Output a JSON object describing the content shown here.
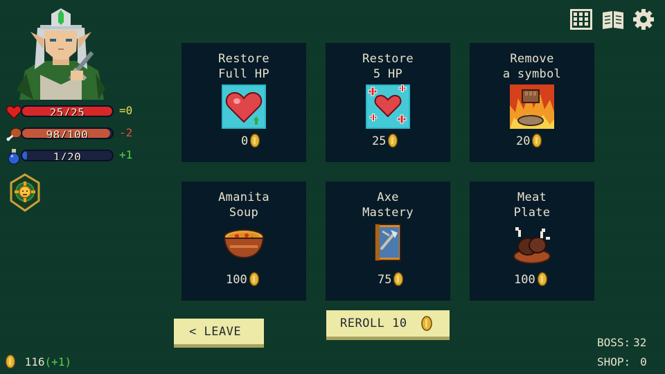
{
  "hud": {
    "stats": [
      {
        "id": "hp",
        "text": "25/25",
        "fill": 1.0,
        "delta": "=0",
        "color": "#d62828",
        "delta_color": "#e8e04a"
      },
      {
        "id": "food",
        "text": "98/100",
        "fill": 0.98,
        "delta": "-2",
        "color": "#c2563a",
        "delta_color": "#e8503a"
      },
      {
        "id": "mana",
        "text": "1/20",
        "fill": 0.05,
        "delta": "+1",
        "color": "#2f5fd0",
        "delta_color": "#58d04a"
      }
    ],
    "gold": "116",
    "gold_change": "(+1)"
  },
  "shop": {
    "items": [
      {
        "title": "Restore\nFull HP",
        "price": "0",
        "icon": "heart-icon"
      },
      {
        "title": "Restore\n5 HP",
        "price": "25",
        "icon": "heart-plus-icon"
      },
      {
        "title": "Remove\na symbol",
        "price": "20",
        "icon": "fist-fire-icon"
      },
      {
        "title": "Amanita\nSoup",
        "price": "100",
        "icon": "soup-bowl-icon"
      },
      {
        "title": "Axe\nMastery",
        "price": "75",
        "icon": "axe-book-icon"
      },
      {
        "title": "Meat\nPlate",
        "price": "100",
        "icon": "meat-plate-icon"
      }
    ],
    "leave_label": "< LEAVE",
    "reroll_label": "REROLL 10"
  },
  "footer": {
    "boss_label": "BOSS:",
    "boss_value": "32",
    "shop_label": "SHOP:",
    "shop_value": "0"
  },
  "colors": {
    "background": "#0f3a2b",
    "card": "#071a27",
    "button": "#ede9a6"
  }
}
